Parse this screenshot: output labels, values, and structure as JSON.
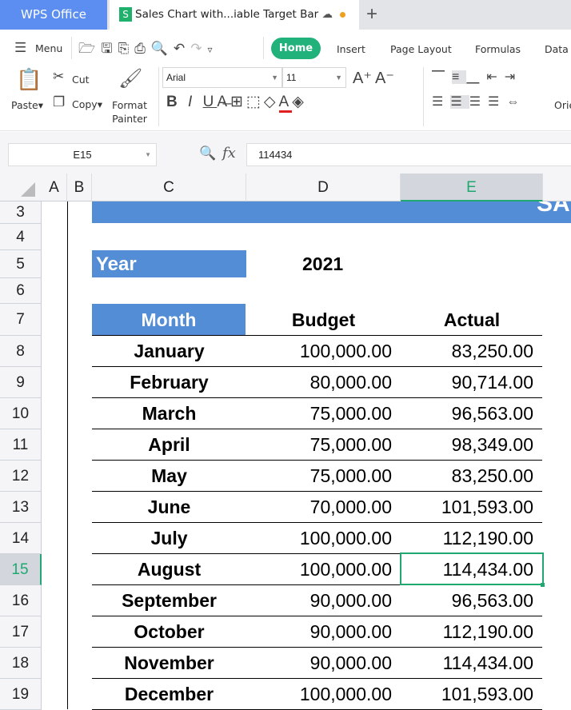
{
  "tabs": {
    "app": "WPS Office",
    "document": "Sales Chart with...iable Target Bar",
    "new_tab": "+"
  },
  "menu": {
    "menu_label": "Menu",
    "tabs": [
      "Home",
      "Insert",
      "Page Layout",
      "Formulas",
      "Data"
    ]
  },
  "ribbon": {
    "paste": "Paste",
    "cut": "Cut",
    "copy": "Copy",
    "format_painter": [
      "Format",
      "Painter"
    ],
    "font": "Arial",
    "size": "11",
    "orientation": "Orie"
  },
  "formula_bar": {
    "name_box": "E15",
    "fx": "fx",
    "value": "114434"
  },
  "columns": [
    "A",
    "B",
    "C",
    "D",
    "E"
  ],
  "rows": [
    "3",
    "4",
    "5",
    "6",
    "7",
    "8",
    "9",
    "10",
    "11",
    "12",
    "13",
    "14",
    "15",
    "16",
    "17",
    "18",
    "19"
  ],
  "sheet": {
    "title_partial": "SA",
    "year_label": "Year",
    "year_value": "2021",
    "headers": [
      "Month",
      "Budget",
      "Actual"
    ],
    "data": [
      [
        "January",
        "100,000.00",
        "83,250.00"
      ],
      [
        "February",
        "80,000.00",
        "90,714.00"
      ],
      [
        "March",
        "75,000.00",
        "96,563.00"
      ],
      [
        "April",
        "75,000.00",
        "98,349.00"
      ],
      [
        "May",
        "75,000.00",
        "83,250.00"
      ],
      [
        "June",
        "70,000.00",
        "101,593.00"
      ],
      [
        "July",
        "100,000.00",
        "112,190.00"
      ],
      [
        "August",
        "100,000.00",
        "114,434.00"
      ],
      [
        "September",
        "90,000.00",
        "96,563.00"
      ],
      [
        "October",
        "90,000.00",
        "112,190.00"
      ],
      [
        "November",
        "90,000.00",
        "114,434.00"
      ],
      [
        "December",
        "100,000.00",
        "101,593.00"
      ]
    ]
  },
  "colors": {
    "accent": "#20b27a",
    "header_fill": "#538dd5",
    "selection": "#1fa870",
    "tab_blue": "#5b8ef0"
  }
}
